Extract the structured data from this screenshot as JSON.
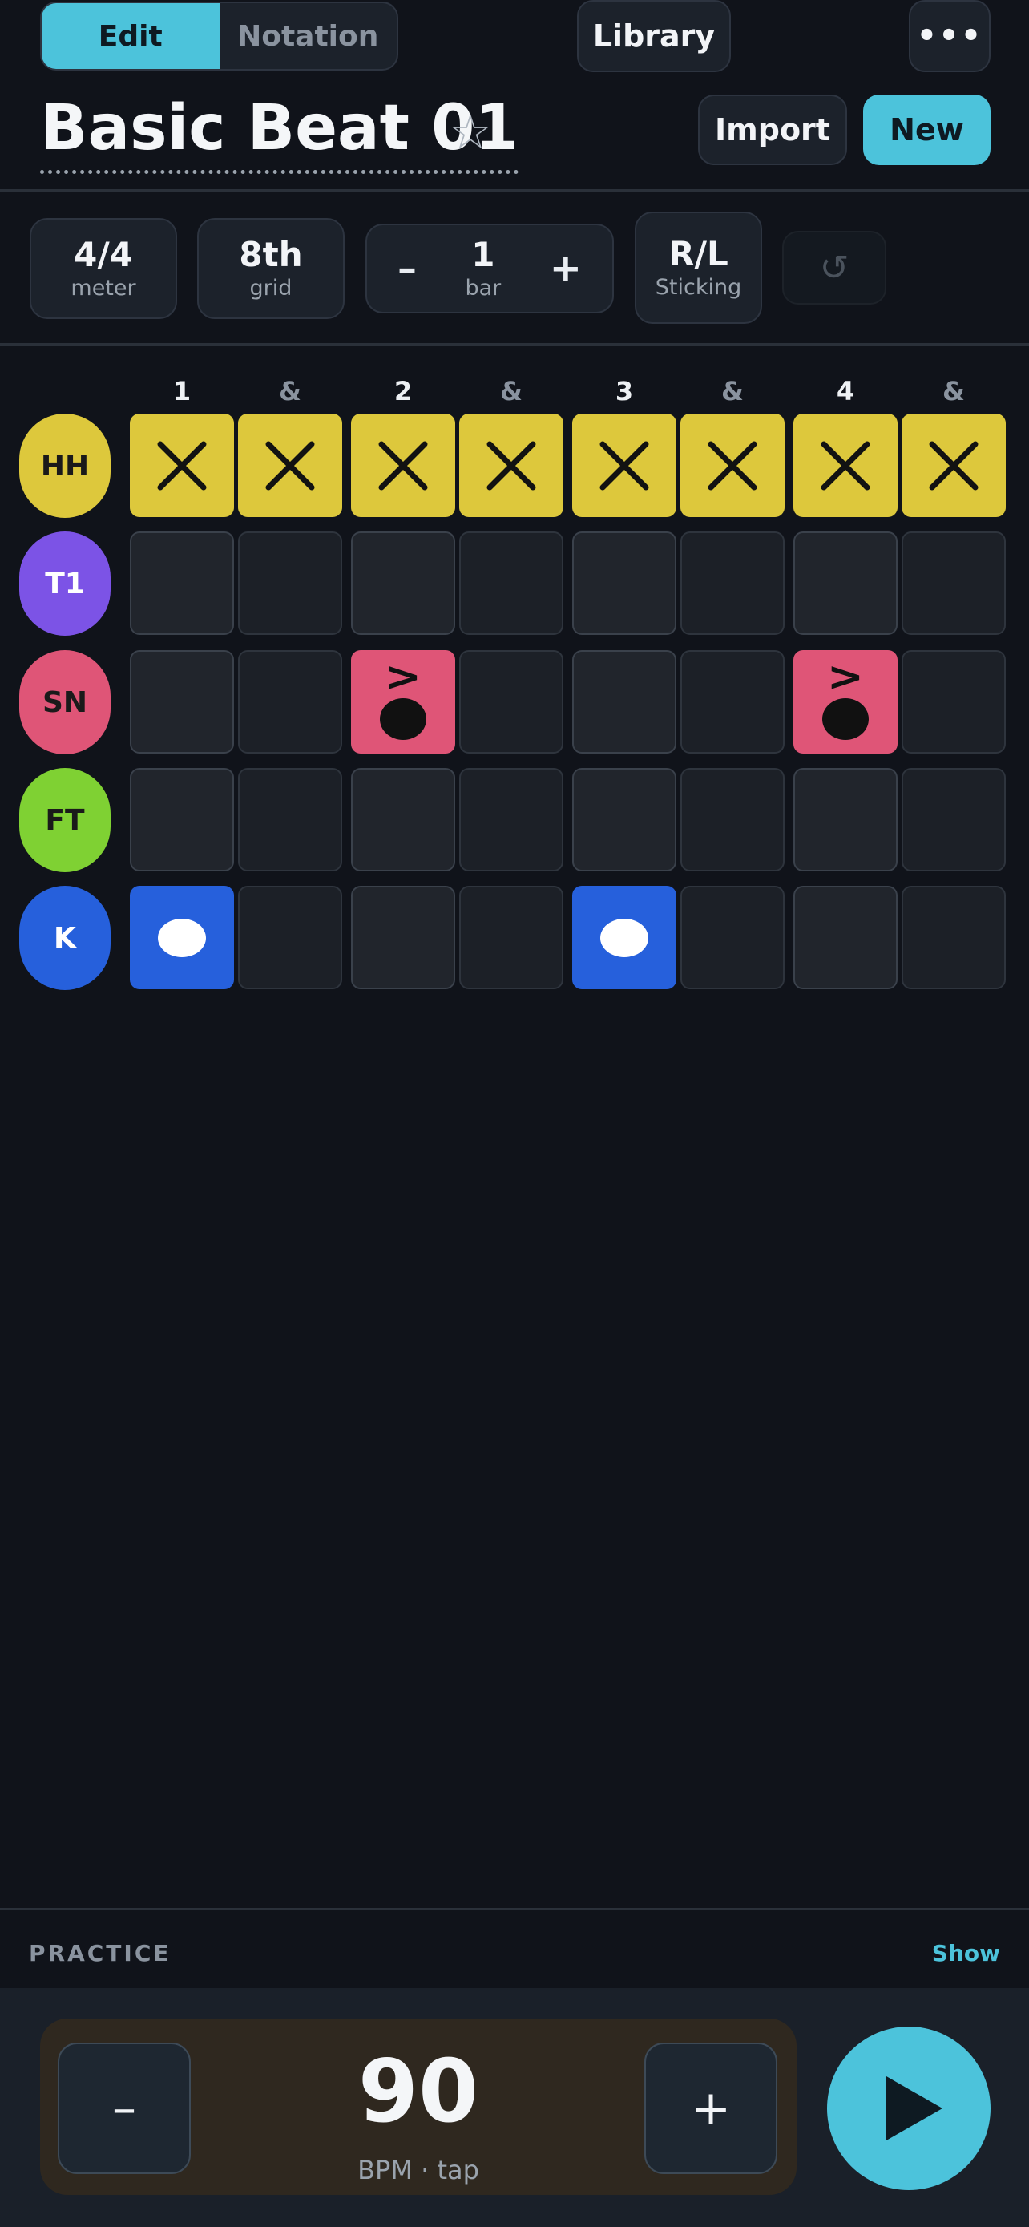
{
  "tabs": {
    "edit": "Edit",
    "notation": "Notation"
  },
  "header": {
    "library": "Library",
    "more": "•••",
    "title": "Basic Beat 01",
    "star": "☆",
    "import": "Import",
    "new": "New"
  },
  "controls": {
    "meter": {
      "value": "4/4",
      "label": "meter"
    },
    "grid": {
      "value": "8th",
      "label": "grid"
    },
    "bars": {
      "minus": "–",
      "value": "1",
      "label": "bar",
      "plus": "+"
    },
    "sticking": {
      "value": "R/L",
      "label": "Sticking"
    },
    "undo": "↺"
  },
  "beats": [
    "1",
    "&",
    "2",
    "&",
    "3",
    "&",
    "4",
    "&"
  ],
  "instruments": [
    {
      "label": "HH",
      "color": "#ddc83c",
      "text_color": "#1a1a1a",
      "pattern": [
        1,
        1,
        1,
        1,
        1,
        1,
        1,
        1
      ],
      "hit": "x"
    },
    {
      "label": "T1",
      "color": "#7c53e6",
      "text_color": "#ffffff",
      "pattern": [
        0,
        0,
        0,
        0,
        0,
        0,
        0,
        0
      ],
      "hit": "dot"
    },
    {
      "label": "SN",
      "color": "#df5577",
      "text_color": "#1a1a1a",
      "pattern": [
        0,
        0,
        2,
        0,
        0,
        0,
        2,
        0
      ],
      "hit": "snare",
      "accent": ">"
    },
    {
      "label": "FT",
      "color": "#7fd133",
      "text_color": "#1a1a1a",
      "pattern": [
        0,
        0,
        0,
        0,
        0,
        0,
        0,
        0
      ],
      "hit": "dot"
    },
    {
      "label": "K",
      "color": "#2660dc",
      "text_color": "#ffffff",
      "pattern": [
        1,
        0,
        0,
        0,
        1,
        0,
        0,
        0
      ],
      "hit": "kick"
    }
  ],
  "practice": {
    "label": "PRACTICE",
    "show": "Show"
  },
  "tempo": {
    "minus": "–",
    "bpm": "90",
    "label": "BPM · tap",
    "plus": "+"
  }
}
